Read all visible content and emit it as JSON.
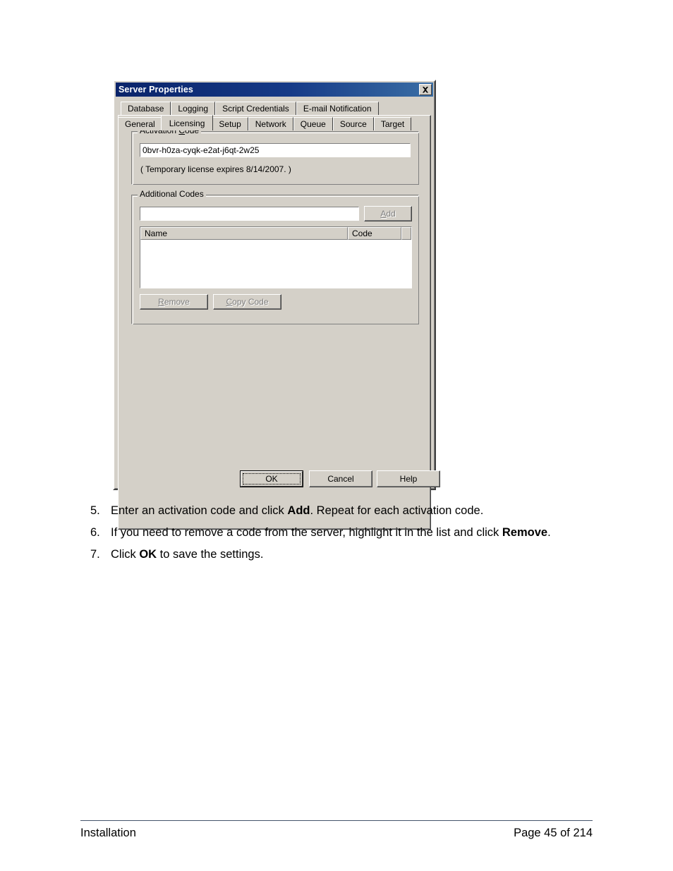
{
  "document": {
    "footer": {
      "left_label": "Installation",
      "page_label": "Page 45 of 214"
    },
    "steps": [
      {
        "number": "5.",
        "parts": [
          {
            "text": "Enter an activation code and click ",
            "bold": false
          },
          {
            "text": "Add",
            "bold": true
          },
          {
            "text": ". Repeat for each activation code.",
            "bold": false
          }
        ]
      },
      {
        "number": "6.",
        "parts": [
          {
            "text": "If you need to remove a code from the server, highlight it in the list and click ",
            "bold": false
          },
          {
            "text": "Remove",
            "bold": true
          },
          {
            "text": ".",
            "bold": false
          }
        ]
      },
      {
        "number": "7.",
        "parts": [
          {
            "text": "Click ",
            "bold": false
          },
          {
            "text": "OK",
            "bold": true
          },
          {
            "text": " to save the settings.",
            "bold": false
          }
        ]
      }
    ]
  },
  "dialog": {
    "title": "Server Properties",
    "close_icon": "close-icon",
    "tabs_row1": [
      {
        "label": "Database",
        "active": false
      },
      {
        "label": "Logging",
        "active": false
      },
      {
        "label": "Script Credentials",
        "active": false
      },
      {
        "label": "E-mail Notification",
        "active": false
      }
    ],
    "tabs_row2": [
      {
        "label": "General",
        "active": false
      },
      {
        "label": "Licensing",
        "active": true
      },
      {
        "label": "Setup",
        "active": false
      },
      {
        "label": "Network",
        "active": false
      },
      {
        "label": "Queue",
        "active": false
      },
      {
        "label": "Source",
        "active": false
      },
      {
        "label": "Target",
        "active": false
      }
    ],
    "activation_group": {
      "title_before": "Activation ",
      "title_accel": "C",
      "title_after": "ode",
      "code_value": "0bvr-h0za-cyqk-e2at-j6qt-2w25",
      "code_placeholder": "",
      "license_note": "( Temporary license expires 8/14/2007. )"
    },
    "additional_group": {
      "title": "Additional Codes",
      "input_value": "",
      "input_placeholder": "",
      "add_button": {
        "before": "",
        "accel": "A",
        "after": "dd",
        "enabled": false
      },
      "columns": [
        {
          "label": "Name"
        },
        {
          "label": "Code"
        }
      ],
      "rows": [],
      "remove_button": {
        "before": "",
        "accel": "R",
        "after": "emove",
        "enabled": false
      },
      "copy_button": {
        "before": "",
        "accel": "C",
        "after": "opy Code",
        "enabled": false
      }
    },
    "buttons": {
      "ok": "OK",
      "cancel": "Cancel",
      "help": "Help"
    }
  },
  "colors": {
    "face": "#d4d0c8",
    "title_start": "#0a246a",
    "title_end": "#3a6ea5",
    "disabled_text": "#808080",
    "footer_rule": "#44546a"
  }
}
